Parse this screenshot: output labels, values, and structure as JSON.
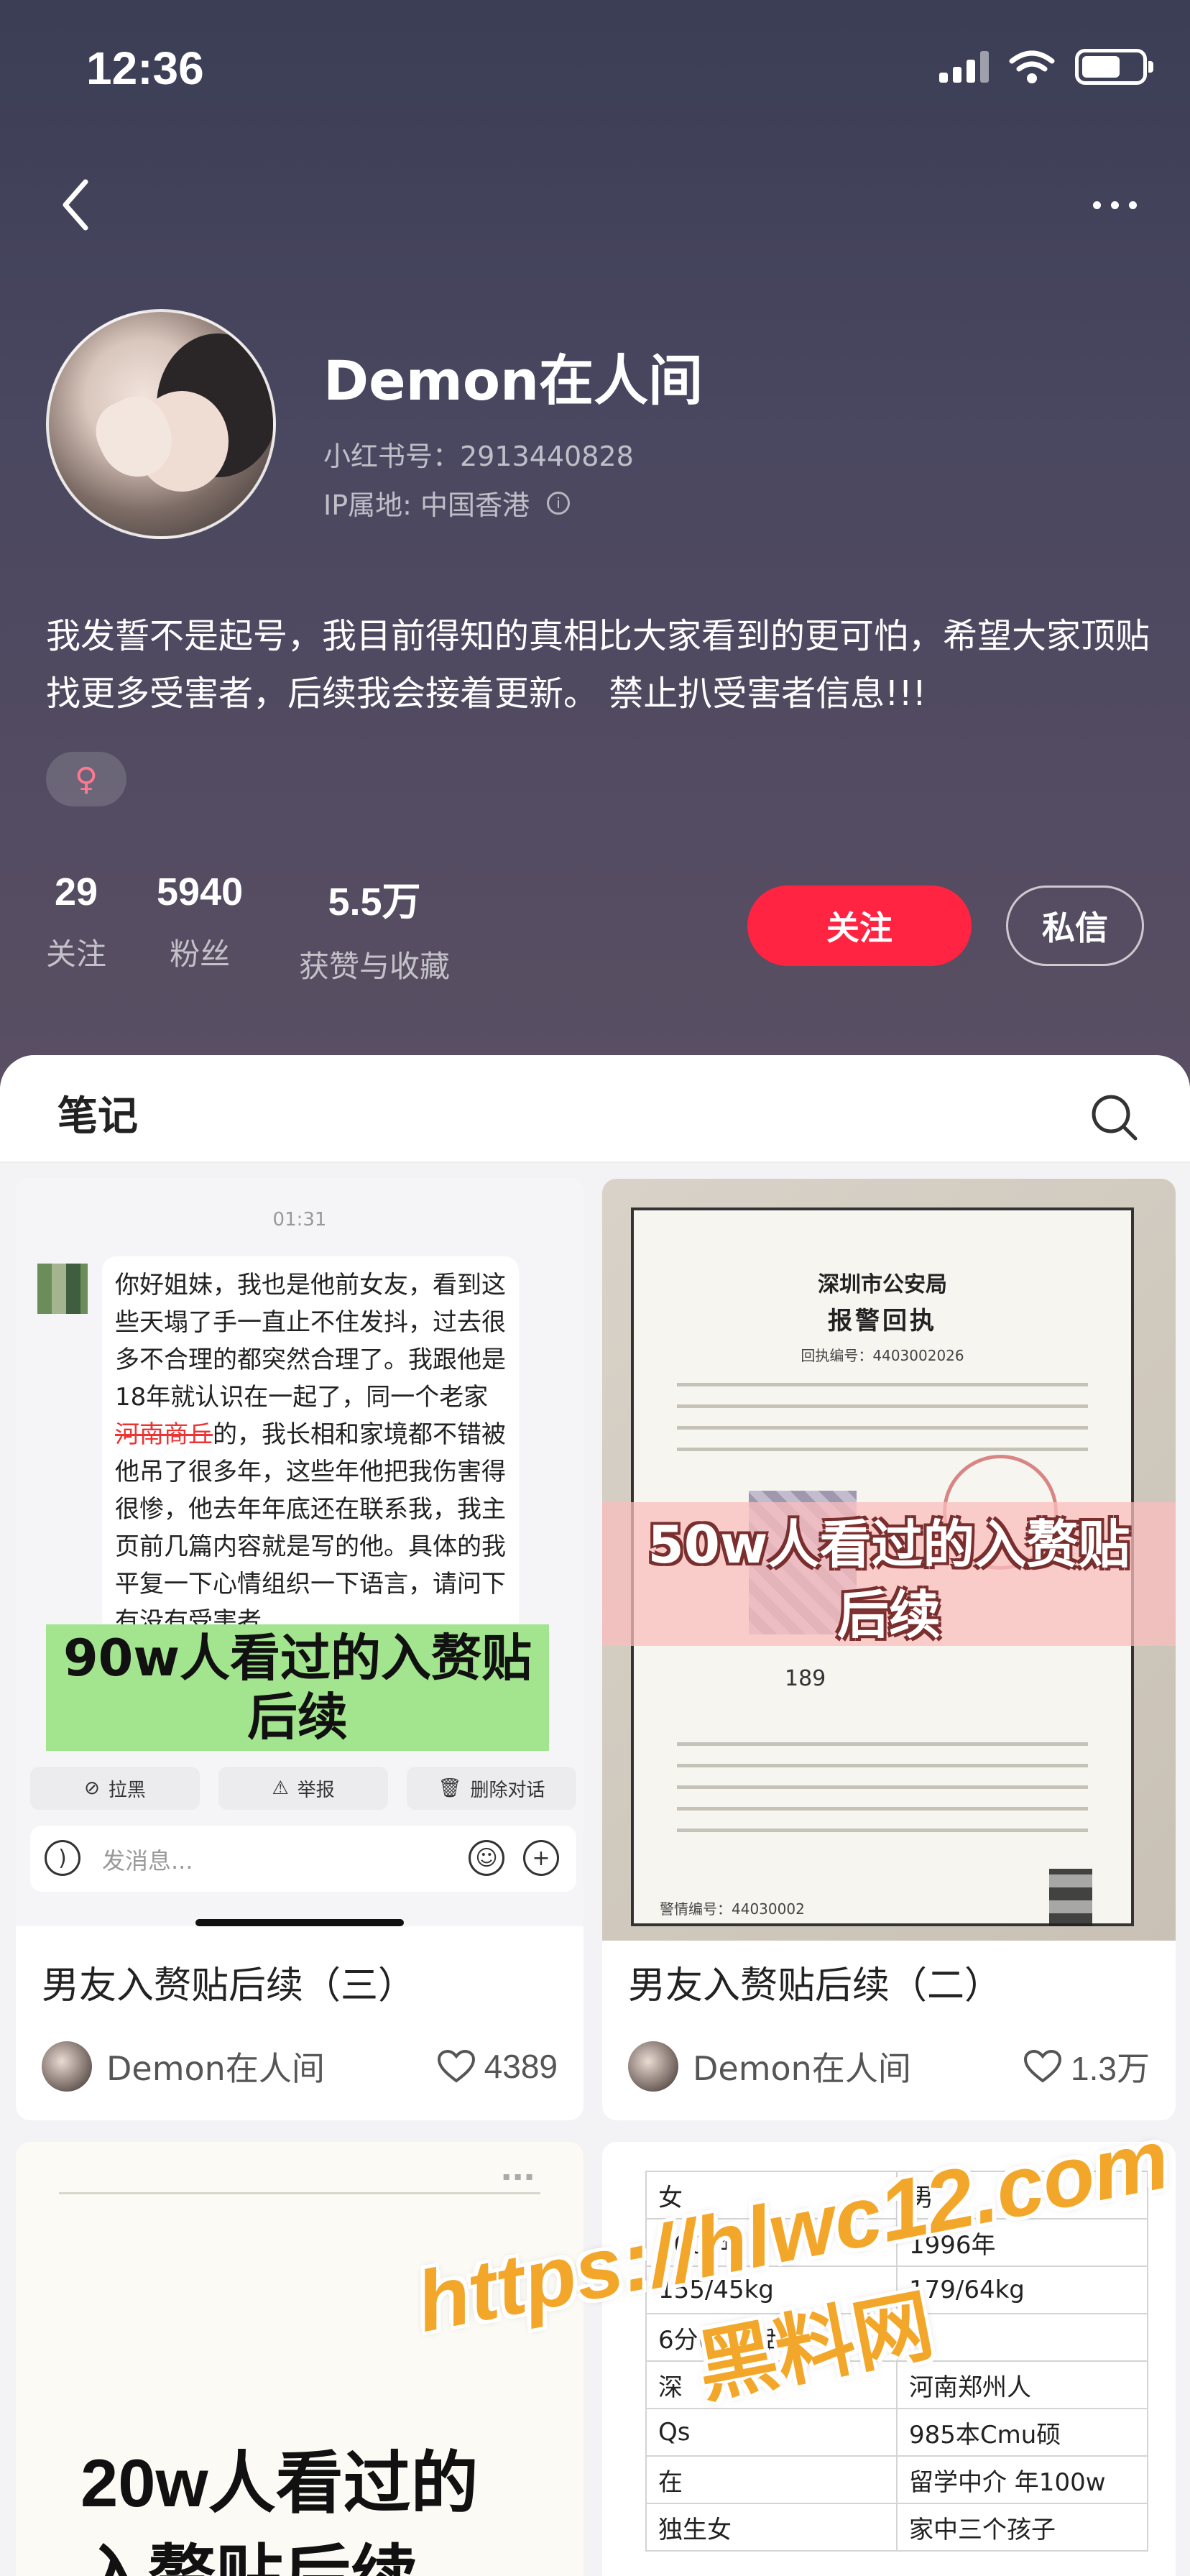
{
  "status_bar": {
    "time": "12:36"
  },
  "profile": {
    "name": "Demon在人间",
    "xhs_id": "小红书号：2913440828",
    "ip_location": "IP属地: 中国香港",
    "bio": "我发誓不是起号，我目前得知的真相比大家看到的更可怕，希望大家顶贴找更多受害者，后续我会接着更新。 禁止扒受害者信息!!!",
    "gender_symbol": "♀"
  },
  "stats": [
    {
      "value": "29",
      "label": "关注"
    },
    {
      "value": "5940",
      "label": "粉丝"
    },
    {
      "value": "5.5万",
      "label": "获赞与收藏"
    }
  ],
  "actions": {
    "follow": "关注",
    "message": "私信"
  },
  "tabs": {
    "notes": "笔记"
  },
  "notes": [
    {
      "title": "男友入赘贴后续（三）",
      "author": "Demon在人间",
      "likes": "4389",
      "cover": {
        "time": "01:31",
        "message": "你好姐妹，我也是他前女友，看到这些天塌了手一直止不住发抖，过去很多不合理的都突然合理了。我跟他是18年就认识在一起了，同一个老家",
        "message_struck": "河南商丘",
        "message_tail": "的，我长相和家境都不错被他吊了很多年，这些年他把我伤害得很惨，他去年年底还在联系我，我主页前几篇内容就是写的他。具体的我平复一下心情组织一下语言，请问下有没有受害者",
        "banner_line1": "90w人看过的入赘贴",
        "banner_line2": "后续",
        "action_block": "拉黑",
        "action_report": "举报",
        "action_delete": "删除对话",
        "input_placeholder": "发消息..."
      }
    },
    {
      "title": "男友入赘贴后续（二）",
      "author": "Demon在人间",
      "likes": "1.3万",
      "cover": {
        "doc_org": "深圳市公安局",
        "doc_title": "报警回执",
        "doc_number": "回执编号：4403002026",
        "banner_line1": "50w人看过的入赘贴",
        "banner_line2": "后续",
        "partial_number": "189",
        "doc_footer": "警情编号：44030002"
      }
    },
    {
      "cover": {
        "line1": "20w人看过的",
        "line2": "入赘贴后续"
      }
    },
    {
      "cover": {
        "table": [
          [
            "女",
            "男"
          ],
          [
            "2002年",
            "1996年"
          ],
          [
            "155/45kg",
            "179/64kg"
          ],
          [
            "6分(小县)甜",
            ""
          ],
          [
            "深",
            "河南郑州人"
          ],
          [
            "Qs",
            "985本Cmu硕"
          ],
          [
            "在",
            "留学中介 年100w"
          ],
          [
            "独生女",
            "家中三个孩子"
          ]
        ]
      }
    }
  ],
  "watermark": {
    "url": "https://hlwc12.com",
    "name": "黑料网"
  },
  "colors": {
    "accent": "#ff2442",
    "header_bg": "#3b3e55",
    "watermark": "#f3a72a",
    "green_banner": "#a3e48f"
  }
}
